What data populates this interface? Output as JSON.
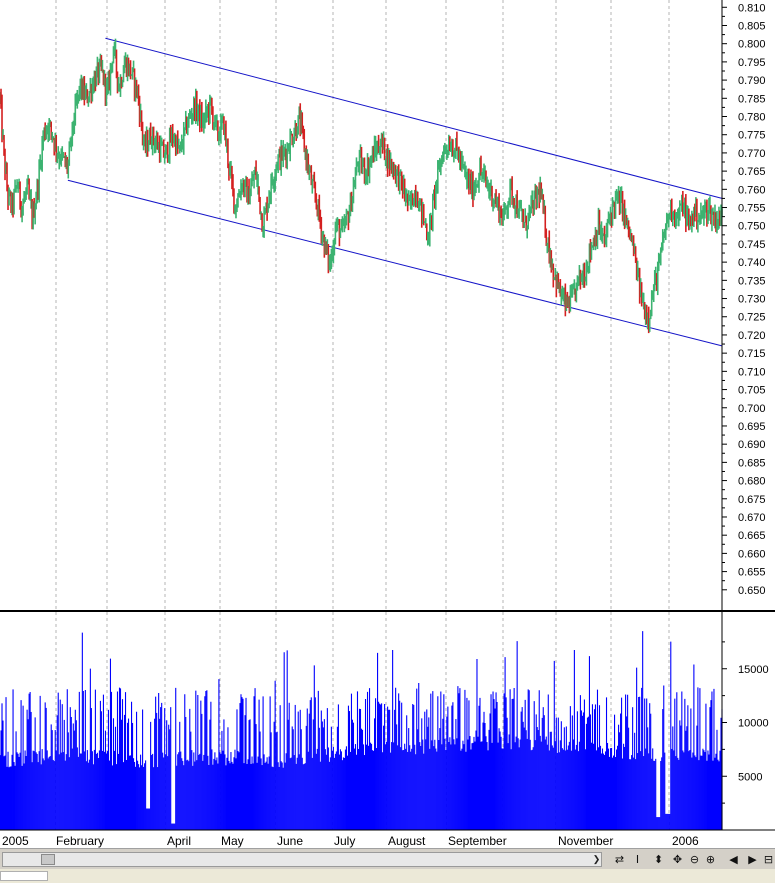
{
  "chart_data": [
    {
      "type": "line",
      "title": "",
      "subtitle": "",
      "xlabel": "",
      "ylabel": "",
      "y_axis_side": "right",
      "ylim": [
        0.645,
        0.812
      ],
      "y_ticks": [
        "0.650",
        "0.655",
        "0.660",
        "0.665",
        "0.670",
        "0.675",
        "0.680",
        "0.685",
        "0.690",
        "0.695",
        "0.700",
        "0.705",
        "0.710",
        "0.715",
        "0.720",
        "0.725",
        "0.730",
        "0.735",
        "0.740",
        "0.745",
        "0.750",
        "0.755",
        "0.760",
        "0.765",
        "0.770",
        "0.775",
        "0.780",
        "0.785",
        "0.790",
        "0.795",
        "0.800",
        "0.805",
        "0.810"
      ],
      "grid": "vertical dashed at month boundaries",
      "colors": {
        "price": "#3cb371",
        "down": "#d42020",
        "channel": "#1515c8",
        "grid": "#b4b4b4"
      },
      "series": [
        {
          "values_by_time": [
            [
              0.0,
              0.785
            ],
            [
              0.005,
              0.77
            ],
            [
              0.011,
              0.758
            ],
            [
              0.017,
              0.755
            ],
            [
              0.024,
              0.762
            ],
            [
              0.03,
              0.755
            ],
            [
              0.038,
              0.76
            ],
            [
              0.045,
              0.752
            ],
            [
              0.053,
              0.762
            ],
            [
              0.06,
              0.775
            ],
            [
              0.066,
              0.778
            ],
            [
              0.073,
              0.775
            ],
            [
              0.08,
              0.77
            ],
            [
              0.087,
              0.768
            ],
            [
              0.094,
              0.766
            ],
            [
              0.103,
              0.78
            ],
            [
              0.111,
              0.788
            ],
            [
              0.12,
              0.785
            ],
            [
              0.13,
              0.79
            ],
            [
              0.14,
              0.793
            ],
            [
              0.149,
              0.786
            ],
            [
              0.157,
              0.799
            ],
            [
              0.165,
              0.788
            ],
            [
              0.173,
              0.795
            ],
            [
              0.182,
              0.792
            ],
            [
              0.191,
              0.786
            ],
            [
              0.2,
              0.771
            ],
            [
              0.209,
              0.775
            ],
            [
              0.219,
              0.772
            ],
            [
              0.229,
              0.769
            ],
            [
              0.239,
              0.775
            ],
            [
              0.249,
              0.77
            ],
            [
              0.259,
              0.778
            ],
            [
              0.27,
              0.783
            ],
            [
              0.281,
              0.778
            ],
            [
              0.291,
              0.783
            ],
            [
              0.301,
              0.775
            ],
            [
              0.31,
              0.778
            ],
            [
              0.318,
              0.765
            ],
            [
              0.326,
              0.755
            ],
            [
              0.335,
              0.762
            ],
            [
              0.344,
              0.758
            ],
            [
              0.354,
              0.765
            ],
            [
              0.364,
              0.75
            ],
            [
              0.374,
              0.76
            ],
            [
              0.384,
              0.768
            ],
            [
              0.395,
              0.77
            ],
            [
              0.405,
              0.775
            ],
            [
              0.415,
              0.779
            ],
            [
              0.423,
              0.77
            ],
            [
              0.431,
              0.762
            ],
            [
              0.44,
              0.755
            ],
            [
              0.449,
              0.745
            ],
            [
              0.457,
              0.739
            ],
            [
              0.465,
              0.75
            ],
            [
              0.475,
              0.748
            ],
            [
              0.485,
              0.755
            ],
            [
              0.496,
              0.768
            ],
            [
              0.507,
              0.765
            ],
            [
              0.518,
              0.77
            ],
            [
              0.528,
              0.773
            ],
            [
              0.538,
              0.768
            ],
            [
              0.548,
              0.765
            ],
            [
              0.557,
              0.761
            ],
            [
              0.567,
              0.755
            ],
            [
              0.576,
              0.76
            ],
            [
              0.585,
              0.753
            ],
            [
              0.594,
              0.747
            ],
            [
              0.603,
              0.76
            ],
            [
              0.613,
              0.77
            ],
            [
              0.623,
              0.773
            ],
            [
              0.634,
              0.77
            ],
            [
              0.645,
              0.763
            ],
            [
              0.655,
              0.76
            ],
            [
              0.665,
              0.765
            ],
            [
              0.675,
              0.761
            ],
            [
              0.686,
              0.757
            ],
            [
              0.697,
              0.752
            ],
            [
              0.707,
              0.76
            ],
            [
              0.717,
              0.755
            ],
            [
              0.727,
              0.75
            ],
            [
              0.737,
              0.755
            ],
            [
              0.748,
              0.76
            ],
            [
              0.757,
              0.747
            ],
            [
              0.766,
              0.738
            ],
            [
              0.775,
              0.732
            ],
            [
              0.784,
              0.728
            ],
            [
              0.793,
              0.73
            ],
            [
              0.802,
              0.735
            ],
            [
              0.811,
              0.738
            ],
            [
              0.82,
              0.745
            ],
            [
              0.829,
              0.75
            ],
            [
              0.837,
              0.745
            ],
            [
              0.845,
              0.753
            ],
            [
              0.853,
              0.757
            ],
            [
              0.861,
              0.756
            ],
            [
              0.868,
              0.75
            ],
            [
              0.876,
              0.745
            ],
            [
              0.884,
              0.735
            ],
            [
              0.891,
              0.728
            ],
            [
              0.898,
              0.725
            ],
            [
              0.906,
              0.733
            ],
            [
              0.914,
              0.74
            ],
            [
              0.922,
              0.75
            ],
            [
              0.93,
              0.755
            ],
            [
              0.938,
              0.752
            ],
            [
              0.946,
              0.756
            ],
            [
              0.954,
              0.75
            ],
            [
              0.962,
              0.754
            ],
            [
              0.97,
              0.752
            ],
            [
              0.98,
              0.755
            ],
            [
              0.99,
              0.752
            ],
            [
              1.0,
              0.752
            ]
          ]
        }
      ],
      "trend_lines": [
        {
          "from_x": 0.146,
          "to_x": 1.0,
          "from_y": 0.8015,
          "to_y": 0.7575
        },
        {
          "from_x": 0.094,
          "to_x": 1.0,
          "from_y": 0.7625,
          "to_y": 0.717
        }
      ]
    },
    {
      "type": "bar",
      "title": "",
      "xlabel": "",
      "ylabel": "",
      "y_axis_side": "right",
      "ylim": [
        0,
        20000
      ],
      "y_ticks": [
        "5000",
        "10000",
        "15000"
      ],
      "colors": {
        "bars": "#0000ff"
      },
      "values_note_free": true,
      "level_profile": [
        [
          0.0,
          6500
        ],
        [
          0.1,
          7000
        ],
        [
          0.2,
          6500
        ],
        [
          0.3,
          6800
        ],
        [
          0.4,
          6500
        ],
        [
          0.5,
          7500
        ],
        [
          0.6,
          7800
        ],
        [
          0.7,
          8200
        ],
        [
          0.8,
          7800
        ],
        [
          0.9,
          7000
        ],
        [
          1.0,
          7000
        ]
      ],
      "spike_range": [
        9000,
        18500
      ],
      "dips": [
        [
          0.205,
          2000
        ],
        [
          0.24,
          600
        ],
        [
          0.912,
          1200
        ],
        [
          0.925,
          1500
        ]
      ]
    }
  ],
  "x_axis_labels": [
    "2005",
    "February",
    "April",
    "May",
    "June",
    "July",
    "August",
    "September",
    "November",
    "2006"
  ],
  "month_gridlines": 14,
  "toolbar": {
    "scroll_right_icon": "arrow-right-icon",
    "buttons": [
      {
        "name": "refresh-icon",
        "glyph": "⇄"
      },
      {
        "name": "cursor-icon",
        "glyph": "I"
      },
      {
        "name": "move-vertical-icon",
        "glyph": "⬍"
      },
      {
        "name": "move-icon",
        "glyph": "✥"
      },
      {
        "name": "zoom-out-icon",
        "glyph": "⊖"
      },
      {
        "name": "zoom-in-icon",
        "glyph": "⊕"
      },
      {
        "name": "scroll-left-icon",
        "glyph": "◀"
      },
      {
        "name": "scroll-right-icon",
        "glyph": "▶"
      },
      {
        "name": "maximize-icon",
        "glyph": "⊟"
      }
    ]
  }
}
